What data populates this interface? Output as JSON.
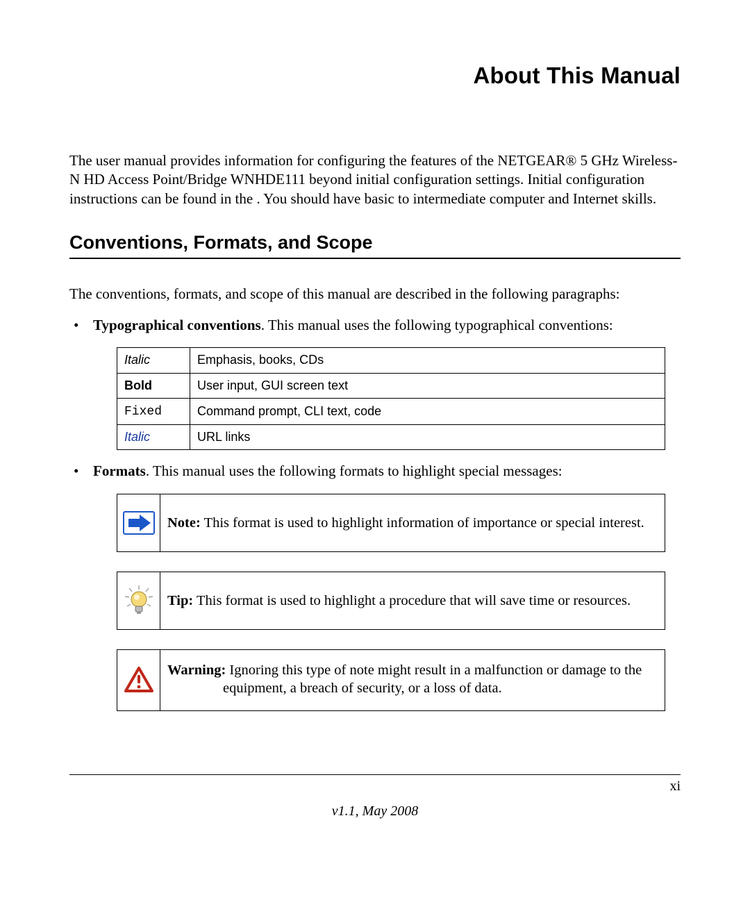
{
  "title": "About This Manual",
  "intro": "The user manual provides information for configuring the features of the NETGEAR® 5 GHz Wireless-N HD Access Point/Bridge WNHDE111 beyond initial configuration settings. Initial configuration instructions can be found in the  . You should have basic to intermediate computer and Internet skills.",
  "section_heading": "Conventions, Formats, and Scope",
  "lead": "The conventions, formats, and scope of this manual are described in the following paragraphs:",
  "bullet_typo_label": "Typographical conventions",
  "bullet_typo_tail": ". This manual uses the following typographical conventions:",
  "conv_table": {
    "rows": [
      {
        "style": "t-italic",
        "label": "Italic",
        "desc": "Emphasis, books, CDs"
      },
      {
        "style": "t-bold",
        "label": "Bold",
        "desc": "User input, GUI screen text"
      },
      {
        "style": "t-fixed",
        "label": "Fixed",
        "desc": "Command prompt, CLI text, code"
      },
      {
        "style": "t-link",
        "label": "Italic",
        "desc": "URL links"
      }
    ]
  },
  "bullet_formats_label": "Formats",
  "bullet_formats_tail": ". This manual uses the following formats to highlight special messages:",
  "callouts": {
    "note_label": "Note:",
    "note_body": " This format is used to highlight information of importance or special interest.",
    "tip_label": "Tip:",
    "tip_body": " This format is used to highlight a procedure that will save time or resources.",
    "warn_label": "Warning:",
    "warn_body_line1": " Ignoring this type of note might result in a malfunction or damage to the",
    "warn_body_line2": "equipment, a breach of security, or a loss of data."
  },
  "footer": {
    "page_num": "xi",
    "version": "v1.1, May 2008"
  }
}
